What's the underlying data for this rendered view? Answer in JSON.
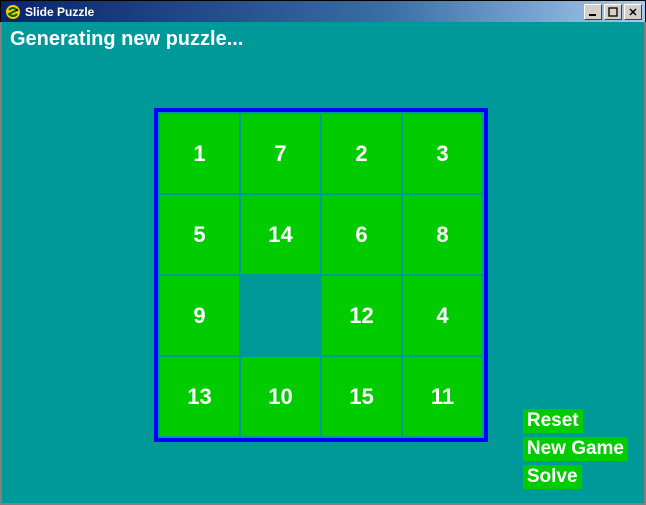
{
  "window": {
    "title": "Slide Puzzle",
    "status": "Generating new puzzle..."
  },
  "board": {
    "rows": 4,
    "cols": 4,
    "tiles": [
      "1",
      "7",
      "2",
      "3",
      "5",
      "14",
      "6",
      "8",
      "9",
      "",
      "12",
      "4",
      "13",
      "10",
      "15",
      "11"
    ]
  },
  "buttons": {
    "reset": "Reset",
    "newgame": "New Game",
    "solve": "Solve"
  },
  "colors": {
    "bg": "#009999",
    "board_border": "#0000ff",
    "tile": "#00cc00",
    "text": "#ffffff"
  }
}
